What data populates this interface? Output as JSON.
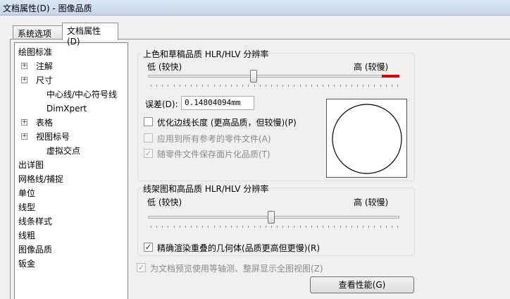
{
  "window": {
    "title": "文档属性(D) - 图像品质"
  },
  "tabs": [
    {
      "label": "系统选项(S)",
      "active": false
    },
    {
      "label": "文档属性(D)",
      "active": true
    }
  ],
  "tree": {
    "items": [
      {
        "label": "绘图标准",
        "level": 0
      },
      {
        "label": "注解",
        "level": 1,
        "expander": "⊞"
      },
      {
        "label": "尺寸",
        "level": 1,
        "expander": "⊞"
      },
      {
        "label": "中心线/中心符号线",
        "level": 1
      },
      {
        "label": "DimXpert",
        "level": 1
      },
      {
        "label": "表格",
        "level": 1,
        "expander": "⊞"
      },
      {
        "label": "视图标号",
        "level": 1,
        "expander": "⊞"
      },
      {
        "label": "虚拟交点",
        "level": 1
      },
      {
        "label": "出详图",
        "level": 0
      },
      {
        "label": "网格线/捕捉",
        "level": 0
      },
      {
        "label": "单位",
        "level": 0
      },
      {
        "label": "线型",
        "level": 0
      },
      {
        "label": "线条样式",
        "level": 0
      },
      {
        "label": "线粗",
        "level": 0
      },
      {
        "label": "图像品质",
        "level": 0,
        "selected": true
      },
      {
        "label": "钣金",
        "level": 0
      }
    ]
  },
  "shaded_group": {
    "legend": "上色和草稿品质 HLR/HLV 分辨率",
    "low_label": "低 (较快)",
    "high_label": "高 (较慢)",
    "slider_value": 0.42,
    "error_label": "误差(D):",
    "error_value": "0.14804094mm",
    "options": [
      {
        "label": "优化边线长度 (更高品质，但较慢)(P)",
        "checked": false,
        "enabled": true
      },
      {
        "label": "应用到所有参考的零件文件(A)",
        "checked": false,
        "enabled": false
      },
      {
        "label": "随零件文件保存面片化品质(T)",
        "checked": true,
        "enabled": false
      }
    ]
  },
  "wireframe_group": {
    "legend": "线架图和高品质 HLR/HLV 分辨率",
    "low_label": "低 (较快)",
    "high_label": "高 (较慢)",
    "slider_value": 0.49,
    "option": {
      "label": "精确渲染重叠的几何体(品质更高但更慢)(R)",
      "checked": true,
      "enabled": true
    }
  },
  "bottom_option": {
    "label": "为文档预览使用等轴测、整屏显示全图视图(Z)",
    "checked": true,
    "enabled": false
  },
  "perf_button": {
    "label": "查看性能(G)"
  },
  "colors": {
    "accent_red": "#dd0000"
  }
}
